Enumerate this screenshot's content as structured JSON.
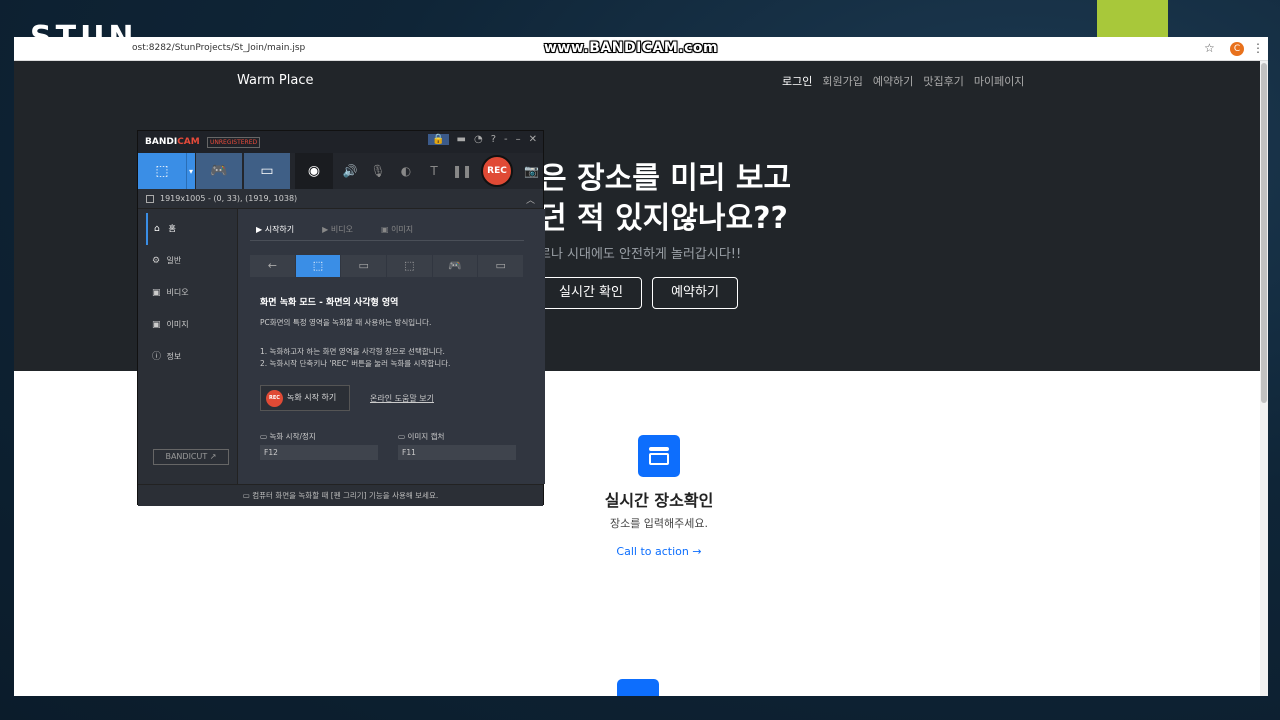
{
  "slide": {
    "logo": "STUN"
  },
  "browser": {
    "url": "ost:8282/StunProjects/St_Join/main.jsp",
    "watermark": "www.BANDICAM.com",
    "avatar_letter": "C"
  },
  "site": {
    "brand": "Warm Place",
    "nav": [
      "로그인",
      "회원가입",
      "예약하기",
      "맛집후기",
      "마이페이지"
    ],
    "hero_title": "은 장소를 미리 보고\n던 적 있지않나요??",
    "hero_sub": "르나 시대에도 안전하게 놀러갑시다!!",
    "btn_primary": "실시간 확인",
    "btn_secondary": "예약하기",
    "feature_title": "실시간 장소확인",
    "feature_desc": "장소를 입력해주세요.",
    "feature_link": "Call to action →"
  },
  "bandicam": {
    "logo_main": "BANDI",
    "logo_accent": "CAM",
    "unregistered": "UNREGISTERED",
    "rec_label": "REC",
    "status": "1919x1005 - (0, 33), (1919, 1038)",
    "sidebar": [
      "홈",
      "일반",
      "비디오",
      "이미지",
      "정보"
    ],
    "bandicut": "BANDICUT ↗",
    "tabs": [
      "시작하기",
      "비디오",
      "이미지"
    ],
    "mode_title": "화면 녹화 모드 - 화면의 사각형 영역",
    "mode_desc": "PC화면의 특정 영역을 녹화할 때 사용하는 방식입니다.",
    "step1": "1. 녹화하고자 하는 화면 영역을 사각형 창으로 선택합니다.",
    "step2": "2. 녹화시작 단축키나 'REC' 버튼을 눌러 녹화를 시작합니다.",
    "start_button": "녹화 시작 하기",
    "help_link": "온라인 도움말 보기",
    "hotkey_rec_label": "녹화 시작/정지",
    "hotkey_rec_value": "F12",
    "hotkey_img_label": "이미지 캡처",
    "hotkey_img_value": "F11",
    "footer": "컴퓨터 화면을 녹화할 때 [펜 그리기] 기능을 사용해 보세요."
  }
}
